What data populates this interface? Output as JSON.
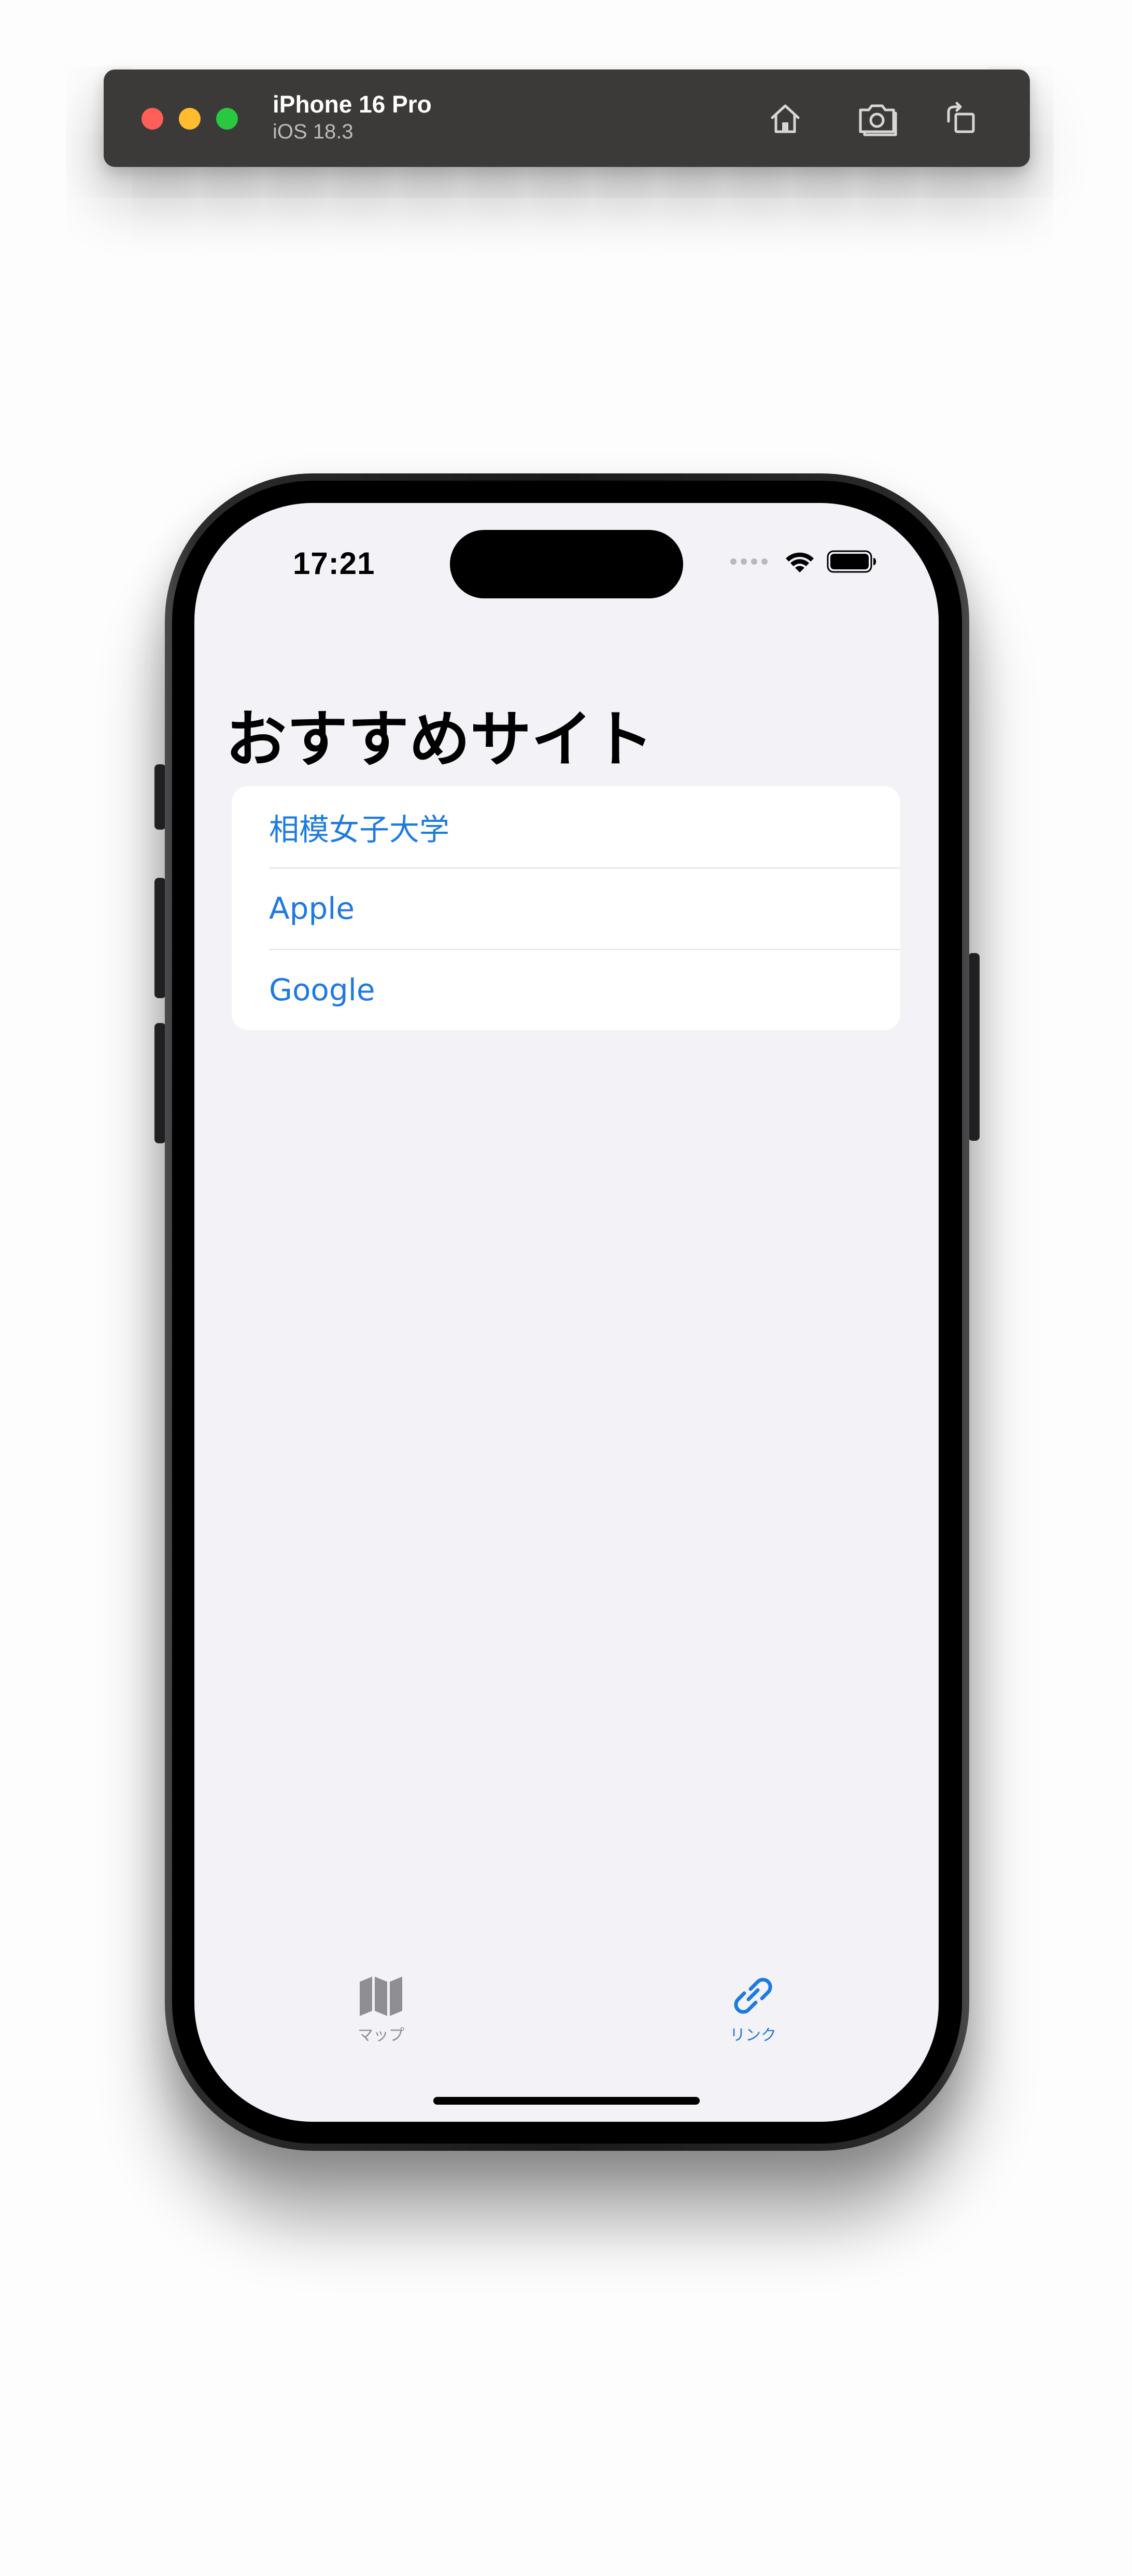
{
  "simulator": {
    "device_name": "iPhone 16 Pro",
    "os_version": "iOS 18.3",
    "controls": {
      "close_color": "#fe5f57",
      "minimize_color": "#febc2e",
      "zoom_color": "#28c840"
    },
    "toolbar_icons": [
      "home-icon",
      "screenshot-icon",
      "rotate-icon"
    ]
  },
  "status_bar": {
    "time": "17:21",
    "icons": [
      "cellular-icon",
      "wifi-icon",
      "battery-icon"
    ]
  },
  "main": {
    "title": "おすすめサイト",
    "links": [
      {
        "label": "相模女子大学"
      },
      {
        "label": "Apple"
      },
      {
        "label": "Google"
      }
    ],
    "link_color": "#1f7ae0"
  },
  "tab_bar": {
    "tabs": [
      {
        "label": "マップ",
        "icon": "map-icon",
        "selected": false,
        "color": "#8e8e93"
      },
      {
        "label": "リンク",
        "icon": "link-icon",
        "selected": true,
        "color": "#1f7ae0"
      }
    ]
  }
}
